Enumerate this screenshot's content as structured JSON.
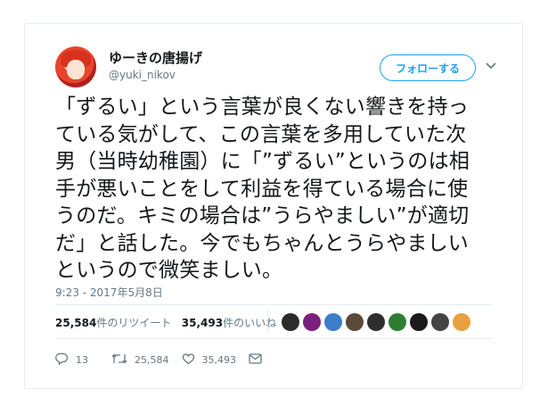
{
  "user": {
    "name": "ゆーきの唐揚げ",
    "handle": "@yuki_nikov"
  },
  "follow_label": "フォローする",
  "tweet_lines": [
    "「ずるい」という言葉が良くない響きを持っ",
    "ている気がして、この言葉を多用していた次",
    "男（当時幼稚園）に「”ずるい”というのは相",
    "手が悪いことをして利益を得ている場合に使",
    "うのだ。キミの場合は”うらやましい”が適切",
    "だ」と話した。今でもちゃんとうらやましい",
    "というので微笑ましい。"
  ],
  "timestamp": "9:23 - 2017年5月8日",
  "stats": {
    "retweets_count": "25,584",
    "retweets_label": "件のリツイート",
    "likes_count": "35,493",
    "likes_label": "件のいいね"
  },
  "liker_avatar_colors": [
    "#2b2b2b",
    "#7a1f7a",
    "#3a7ec9",
    "#5a4a3a",
    "#2e2e2e",
    "#2e7d32",
    "#1b1b1b",
    "#444444",
    "#e8a040"
  ],
  "actions": {
    "reply_count": "13",
    "retweet_count": "25,584",
    "like_count": "35,493"
  },
  "icons": [
    "reply-icon",
    "retweet-icon",
    "like-icon",
    "message-icon",
    "chevron-down-icon"
  ]
}
